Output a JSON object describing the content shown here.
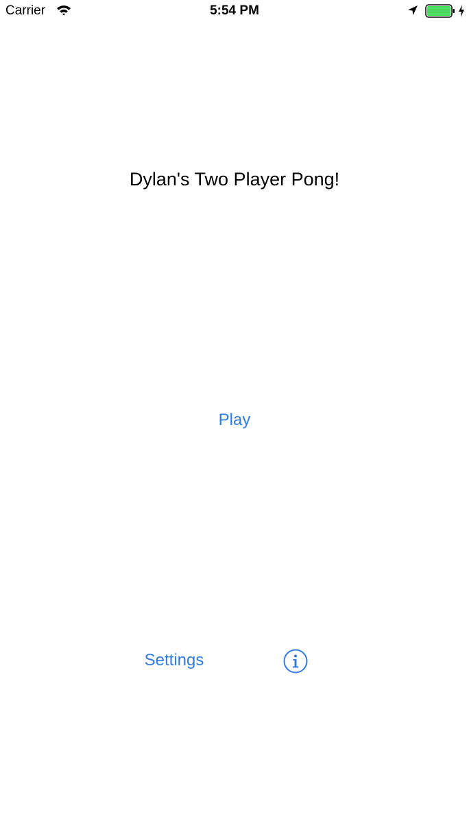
{
  "status_bar": {
    "carrier": "Carrier",
    "time": "5:54 PM",
    "icons": [
      "wifi-icon",
      "location-icon",
      "battery-icon",
      "charging-icon"
    ],
    "battery_color": "#4cd964"
  },
  "main": {
    "title": "Dylan's Two Player Pong!",
    "play_label": "Play",
    "settings_label": "Settings",
    "info_icon": "info-icon"
  },
  "colors": {
    "accent": "#2f7ce6",
    "text": "#000000",
    "background": "#ffffff"
  }
}
